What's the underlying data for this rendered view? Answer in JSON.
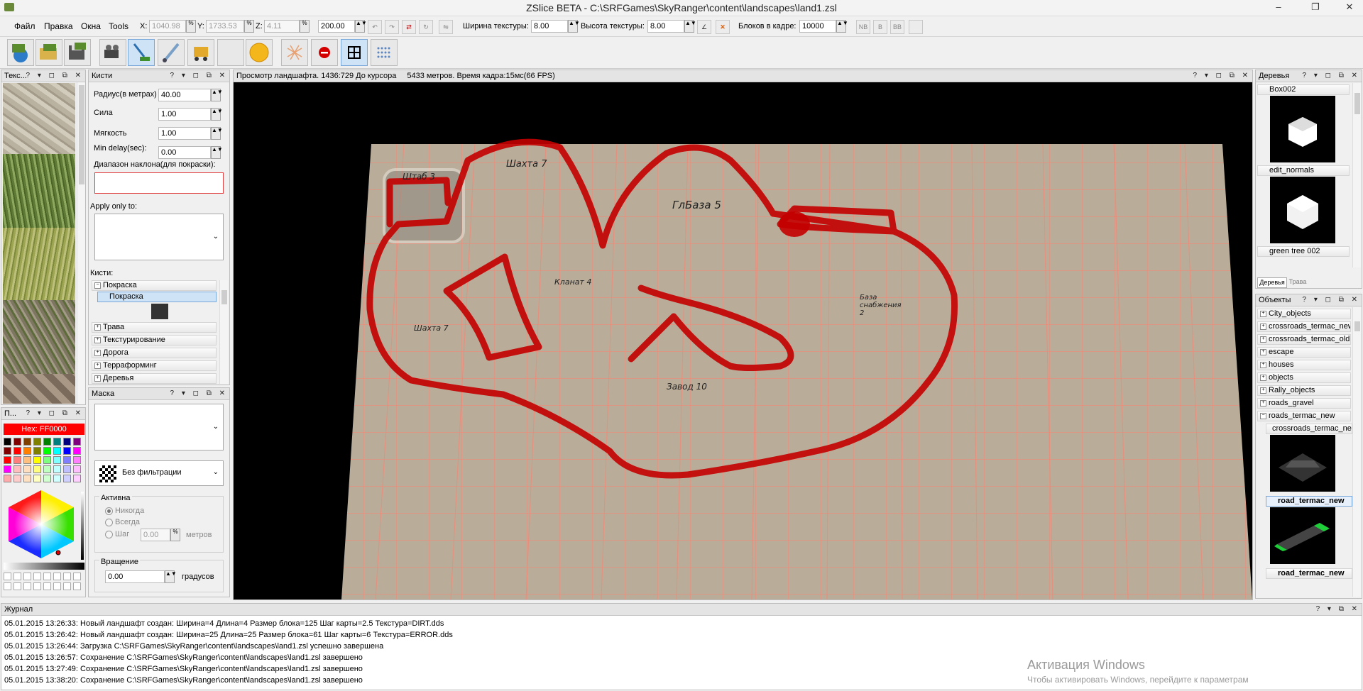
{
  "window": {
    "title": "ZSlice BETA - C:\\SRFGames\\SkyRanger\\content\\landscapes\\land1.zsl",
    "controls": [
      "–",
      "❐",
      "✕"
    ]
  },
  "menu": [
    "Файл",
    "Правка",
    "Окна",
    "Tools"
  ],
  "coords": {
    "x_label": "X:",
    "x": "1040.98",
    "y_label": "Y:",
    "y": "1733.53",
    "z_label": "Z:",
    "z": "4.11"
  },
  "params": {
    "brush_value": "200.00",
    "tex_width_label": "Ширина текстуры:",
    "tex_width": "8.00",
    "tex_height_label": "Высота текстуры:",
    "tex_height": "8.00",
    "blocks_label": "Блоков в кадре:",
    "blocks": "10000",
    "nb": "NB",
    "b": "B",
    "bb": "BB"
  },
  "textures_panel": {
    "title": "Текс..."
  },
  "brushes_panel": {
    "title": "Кисти",
    "radius_label": "Радиус(в метрах)",
    "radius": "40.00",
    "strength_label": "Сила",
    "strength": "1.00",
    "softness_label": "Мягкость",
    "softness": "1.00",
    "min_delay_label": "Min delay(sec):",
    "min_delay": "0.00",
    "slope_label": "Диапазон наклона(для покраски):",
    "apply_only_label": "Apply only to:",
    "brushes_label": "Кисти:",
    "categories": [
      "Покраска",
      "Трава",
      "Текстурирование",
      "Дорога",
      "Терраформинг",
      "Деревья"
    ],
    "selected_brush": "Покраска"
  },
  "mask_panel": {
    "title": "Маска",
    "filter": "Без фильтрации",
    "active_label": "Активна",
    "never": "Никогда",
    "always": "Всегда",
    "step": "Шаг",
    "step_value": "0.00",
    "meters": "метров",
    "rotation_label": "Вращение",
    "rotation": "0.00",
    "degrees": "градусов"
  },
  "palette_panel": {
    "title": "П...",
    "hex": "Hex: FF0000"
  },
  "viewport": {
    "header": "Просмотр ландшафта. 1436:729 До курсора",
    "stats": "5433 метров. Время кадра:15мс(66 FPS)",
    "map_labels": [
      {
        "text": "Штаб 3"
      },
      {
        "text": "Шахта 7"
      },
      {
        "text": "ГлБаза 5"
      },
      {
        "text": "Кланат 4"
      },
      {
        "text": "База снабжения 2"
      },
      {
        "text": "Шахта 7"
      },
      {
        "text": "Завод 10"
      }
    ]
  },
  "trees_panel": {
    "title": "Деревья",
    "items": [
      "Box002",
      "edit_normals",
      "green tree 002"
    ],
    "tabs": [
      "Деревья",
      "Трава"
    ]
  },
  "objects_panel": {
    "title": "Объекты",
    "items": [
      "City_objects",
      "crossroads_termac_new",
      "crossroads_termac_old",
      "escape",
      "houses",
      "objects",
      "Rally_objects",
      "roads_gravel",
      "roads_termac_new"
    ],
    "children": [
      "crossroads_termac_ne",
      "road_termac_new",
      "road_termac_new"
    ]
  },
  "journal": {
    "title": "Журнал",
    "lines": [
      "05.01.2015 13:26:33: Новый ландшафт создан: Ширина=4 Длина=4 Размер блока=125 Шаг карты=2.5 Текстура=DIRT.dds",
      "05.01.2015 13:26:42: Новый ландшафт создан: Ширина=25 Длина=25 Размер блока=61 Шаг карты=6 Текстура=ERROR.dds",
      "05.01.2015 13:26:44: Загрузка C:\\SRFGames\\SkyRanger\\content\\landscapes\\land1.zsl успешно завершена",
      "05.01.2015 13:26:57: Сохранение C:\\SRFGames\\SkyRanger\\content\\landscapes\\land1.zsl завершено",
      "05.01.2015 13:27:49: Сохранение C:\\SRFGames\\SkyRanger\\content\\landscapes\\land1.zsl завершено",
      "05.01.2015 13:38:20: Сохранение C:\\SRFGames\\SkyRanger\\content\\landscapes\\land1.zsl завершено"
    ]
  },
  "watermark": {
    "title": "Активация Windows",
    "subtitle": "Чтобы активировать Windows, перейдите к параметрам"
  },
  "colors": {
    "accent_red": "#ff0000",
    "selection": "#cfe3f7",
    "terrain": "#b8ab98",
    "grid": "#f28a7a",
    "stroke": "#c20000"
  }
}
